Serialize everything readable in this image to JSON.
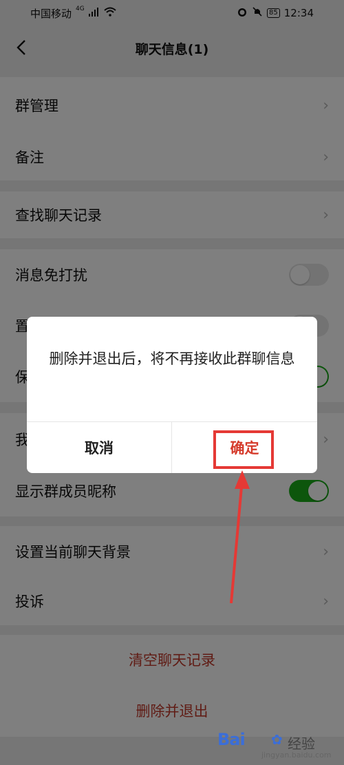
{
  "status_bar": {
    "carrier": "中国移动",
    "network": "4G",
    "battery": "85",
    "time": "12:34"
  },
  "nav": {
    "title": "聊天信息(1)"
  },
  "settings": {
    "group_manage": "群管理",
    "remark": "备注",
    "find_history": "查找聊天记录",
    "mute": "消息免打扰",
    "pin_partial": "置",
    "save_partial": "保",
    "my_partial": "我",
    "show_nicknames": "显示群成员昵称",
    "set_background": "设置当前聊天背景",
    "complaint": "投诉"
  },
  "actions": {
    "clear_history": "清空聊天记录",
    "delete_exit": "删除并退出"
  },
  "dialog": {
    "message": "删除并退出后，将不再接收此群聊信息",
    "cancel": "取消",
    "confirm": "确定"
  },
  "watermark": {
    "brand": "Bai",
    "text": "经验",
    "url": "jingyan.baidu.com"
  },
  "colors": {
    "accent_red": "#d53a2b",
    "toggle_on": "#1aad19",
    "annotation_red": "#e53935"
  }
}
